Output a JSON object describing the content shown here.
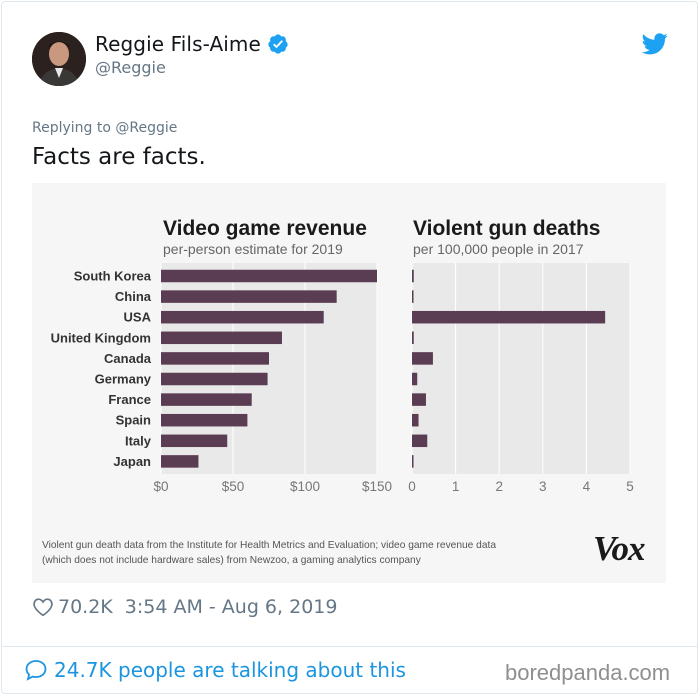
{
  "tweet": {
    "author_name": "Reggie Fils-Aime",
    "author_handle": "@Reggie",
    "replying_to": "Replying to @Reggie",
    "text": "Facts are facts.",
    "likes": "70.2K",
    "time": "3:54 AM - Aug 6, 2019",
    "talking": "24.7K people are talking about this"
  },
  "watermark": "boredpanda.com",
  "colors": {
    "bar": "#5a3d52",
    "link": "#1b95e0",
    "verified": "#1da1f2",
    "muted": "#657786"
  },
  "icons": [
    "avatar",
    "verified-badge-icon",
    "twitter-bird-icon",
    "heart-icon",
    "speech-bubble-icon"
  ],
  "chart_data": [
    {
      "type": "bar",
      "orientation": "horizontal",
      "title": "Video game revenue",
      "subtitle": "per-person estimate for 2019",
      "categories": [
        "South Korea",
        "China",
        "USA",
        "United Kingdom",
        "Canada",
        "Germany",
        "France",
        "Spain",
        "Italy",
        "Japan"
      ],
      "values": [
        150,
        122,
        113,
        84,
        75,
        74,
        63,
        60,
        46,
        26
      ],
      "xlim": [
        0,
        150
      ],
      "ticks": [
        "$0",
        "$50",
        "$100",
        "$150"
      ],
      "tick_values": [
        0,
        50,
        100,
        150
      ],
      "grid": true
    },
    {
      "type": "bar",
      "orientation": "horizontal",
      "title": "Violent gun deaths",
      "subtitle": "per 100,000 people in 2017",
      "categories": [
        "South Korea",
        "China",
        "USA",
        "United Kingdom",
        "Canada",
        "Germany",
        "France",
        "Spain",
        "Italy",
        "Japan"
      ],
      "values": [
        0.04,
        0.03,
        4.43,
        0.04,
        0.48,
        0.12,
        0.32,
        0.15,
        0.35,
        0.02
      ],
      "xlim": [
        0,
        5
      ],
      "ticks": [
        "0",
        "1",
        "2",
        "3",
        "4",
        "5"
      ],
      "tick_values": [
        0,
        1,
        2,
        3,
        4,
        5
      ],
      "grid": true
    }
  ],
  "footnote_lines": [
    "Violent gun death data from the Institute for Health Metrics and Evaluation; video game revenue data",
    "(which does not include hardware sales) from Newzoo, a gaming analytics company"
  ],
  "brand": "Vox"
}
